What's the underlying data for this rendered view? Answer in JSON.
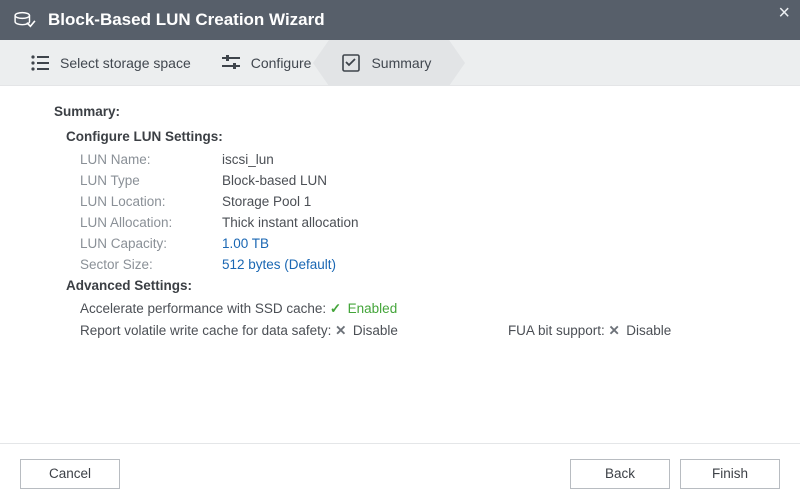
{
  "title": "Block-Based LUN Creation Wizard",
  "steps": {
    "select": "Select storage space",
    "configure": "Configure",
    "summary": "Summary"
  },
  "summary": {
    "heading": "Summary:",
    "configure_heading": "Configure LUN Settings:",
    "fields": {
      "name_label": "LUN Name:",
      "name_value": "iscsi_lun",
      "type_label": "LUN Type",
      "type_value": "Block-based LUN",
      "location_label": "LUN Location:",
      "location_value": "Storage Pool 1",
      "allocation_label": "LUN Allocation:",
      "allocation_value": "Thick instant allocation",
      "capacity_label": "LUN Capacity:",
      "capacity_value": "1.00 TB",
      "sector_label": "Sector Size:",
      "sector_value": "512 bytes (Default)"
    },
    "advanced_heading": "Advanced Settings:",
    "advanced": {
      "ssd_cache_label": "Accelerate performance with SSD cache:",
      "ssd_cache_status": "Enabled",
      "volatile_label": "Report volatile write cache for data safety:",
      "volatile_status": "Disable",
      "fua_label": "FUA bit support:",
      "fua_status": "Disable"
    }
  },
  "buttons": {
    "cancel": "Cancel",
    "back": "Back",
    "finish": "Finish"
  }
}
